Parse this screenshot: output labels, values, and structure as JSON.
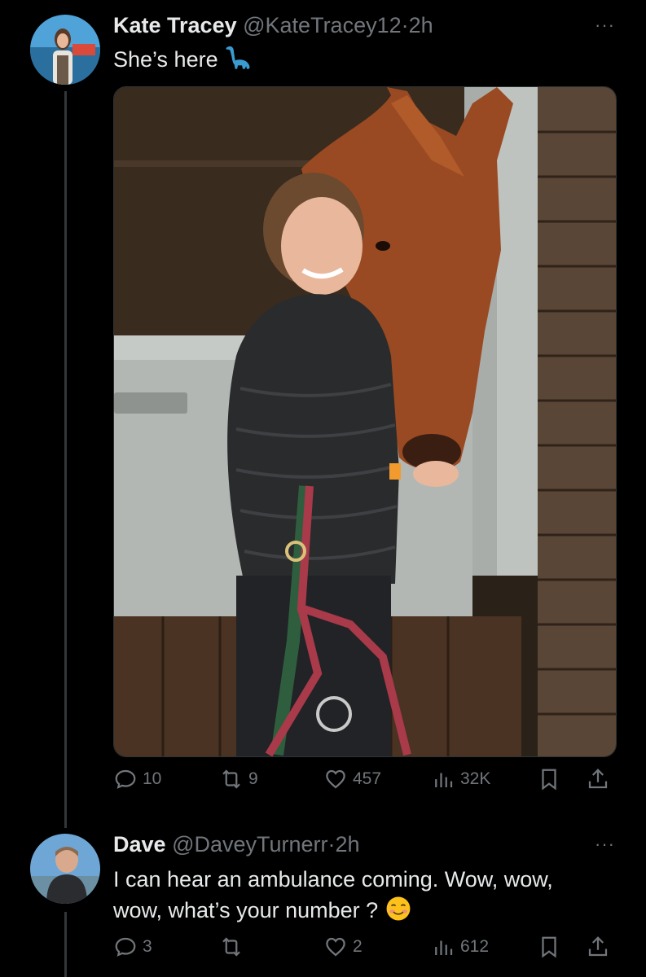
{
  "tweet": {
    "name": "Kate Tracey",
    "handle": "@KateTracey12",
    "sep": "·",
    "time": "2h",
    "more": "···",
    "text": "She’s here",
    "emoji_icon": "sauropod-emoji",
    "stats": {
      "replies": "10",
      "retweets": "9",
      "likes": "457",
      "views": "32K"
    }
  },
  "reply": {
    "name": "Dave",
    "handle": "@DaveyTurnerr",
    "sep": "·",
    "time": "2h",
    "more": "···",
    "text_line1": "I can hear an ambulance coming. Wow, wow,",
    "text_line2": "wow, what’s your number ?",
    "emoji_icon": "smiling-face-emoji",
    "stats": {
      "replies": "3",
      "retweets": "",
      "likes": "2",
      "views": "612"
    }
  },
  "colors": {
    "background": "#000000",
    "text": "#e7e9ea",
    "muted": "#71767b",
    "thread_line": "#333639"
  }
}
